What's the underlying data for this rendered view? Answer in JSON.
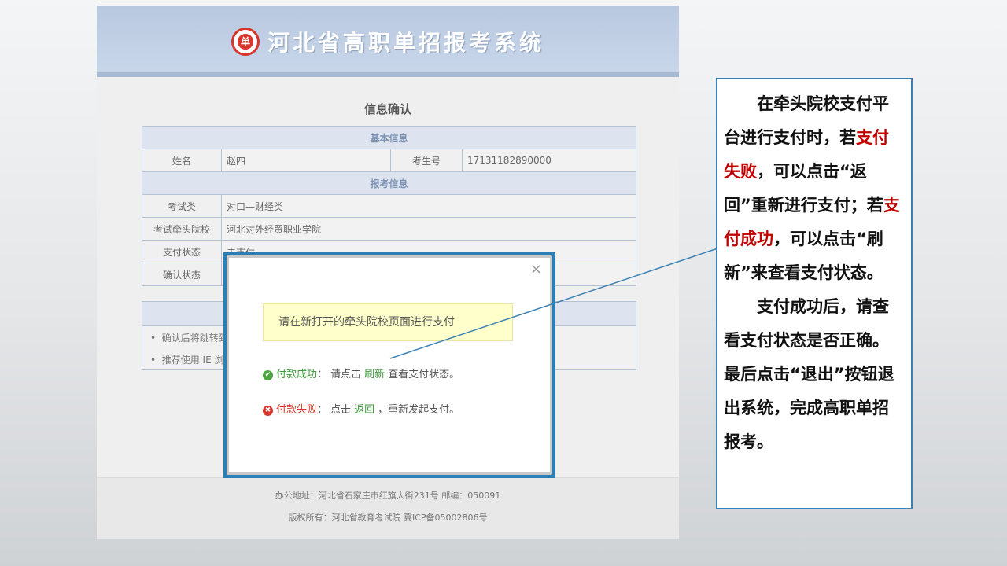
{
  "header": {
    "title": "河北省高职单招报考系统",
    "logo_text": "单"
  },
  "page": {
    "title": "信息确认"
  },
  "basic": {
    "section": "基本信息",
    "name_label": "姓名",
    "name_value": "赵四",
    "id_label": "考生号",
    "id_value": "17131182890000"
  },
  "exam": {
    "section": "报考信息",
    "rows": [
      {
        "label": "考试类",
        "value": "对口—财经类"
      },
      {
        "label": "考试牵头院校",
        "value": "河北对外经贸职业学院"
      },
      {
        "label": "支付状态",
        "value": "未支付"
      },
      {
        "label": "确认状态",
        "value": ""
      }
    ]
  },
  "notes": {
    "items": [
      "确认后将跳转到",
      "推荐使用 IE 浏"
    ]
  },
  "footer": {
    "address": "办公地址：河北省石家庄市红旗大街231号    邮编：050091",
    "copyright": "版权所有：河北省教育考试院 冀ICP备05002806号"
  },
  "modal": {
    "close": "×",
    "message": "请在新打开的牵头院校页面进行支付",
    "ok_icon": "✔",
    "ok_label": "付款成功",
    "ok_pre": "： 请点击",
    "ok_link": "刷新",
    "ok_post": "查看支付状态。",
    "err_icon": "✖",
    "err_label": "付款失败",
    "err_pre": "： 点击",
    "err_link": "返回",
    "err_post": "，重新发起支付。"
  },
  "callout": {
    "p1a": "在牵头院校支付平台进行支付时，若",
    "p1b": "支付失败",
    "p1c": "，可以点击“返回”重新进行支付；若",
    "p1d": "支付成功",
    "p1e": "，可以点击“刷新”来查看支付状态。",
    "p2": "支付成功后，请查看支付状态是否正确。最后点击“退出”按钮退出系统，完成高职单招报考。"
  },
  "colors": {
    "accent": "#2c7fb5",
    "highlight": "#c00000",
    "success": "#3e9a3a",
    "error": "#d9352c"
  }
}
